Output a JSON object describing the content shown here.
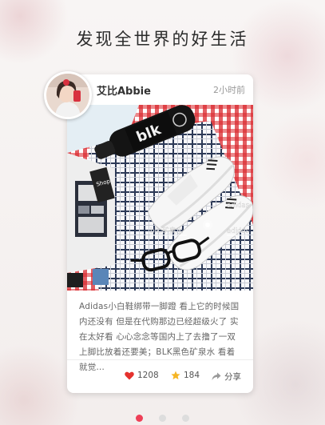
{
  "page": {
    "title": "发现全世界的好生活"
  },
  "post": {
    "user_name": "艾比Abbie",
    "time": "2小时前",
    "text": "Adidas小白鞋绑带一脚蹬 看上它的时候国内还没有 但是在代购那边已经超级火了 实在太好看 心心念念等国内上了去撸了一双 上脚比放着还要美；BLK黑色矿泉水 看着就觉…",
    "photo_tags": [
      "blk",
      "adidas",
      "Shop",
      "blk.矿泉水",
      "adidas"
    ],
    "likes": "1208",
    "stars": "184",
    "share_label": "分享"
  },
  "carousel": {
    "pages": 3,
    "active": 1
  },
  "colors": {
    "accent": "#ee3f57",
    "like": "#e5322e",
    "star": "#f5b524"
  }
}
